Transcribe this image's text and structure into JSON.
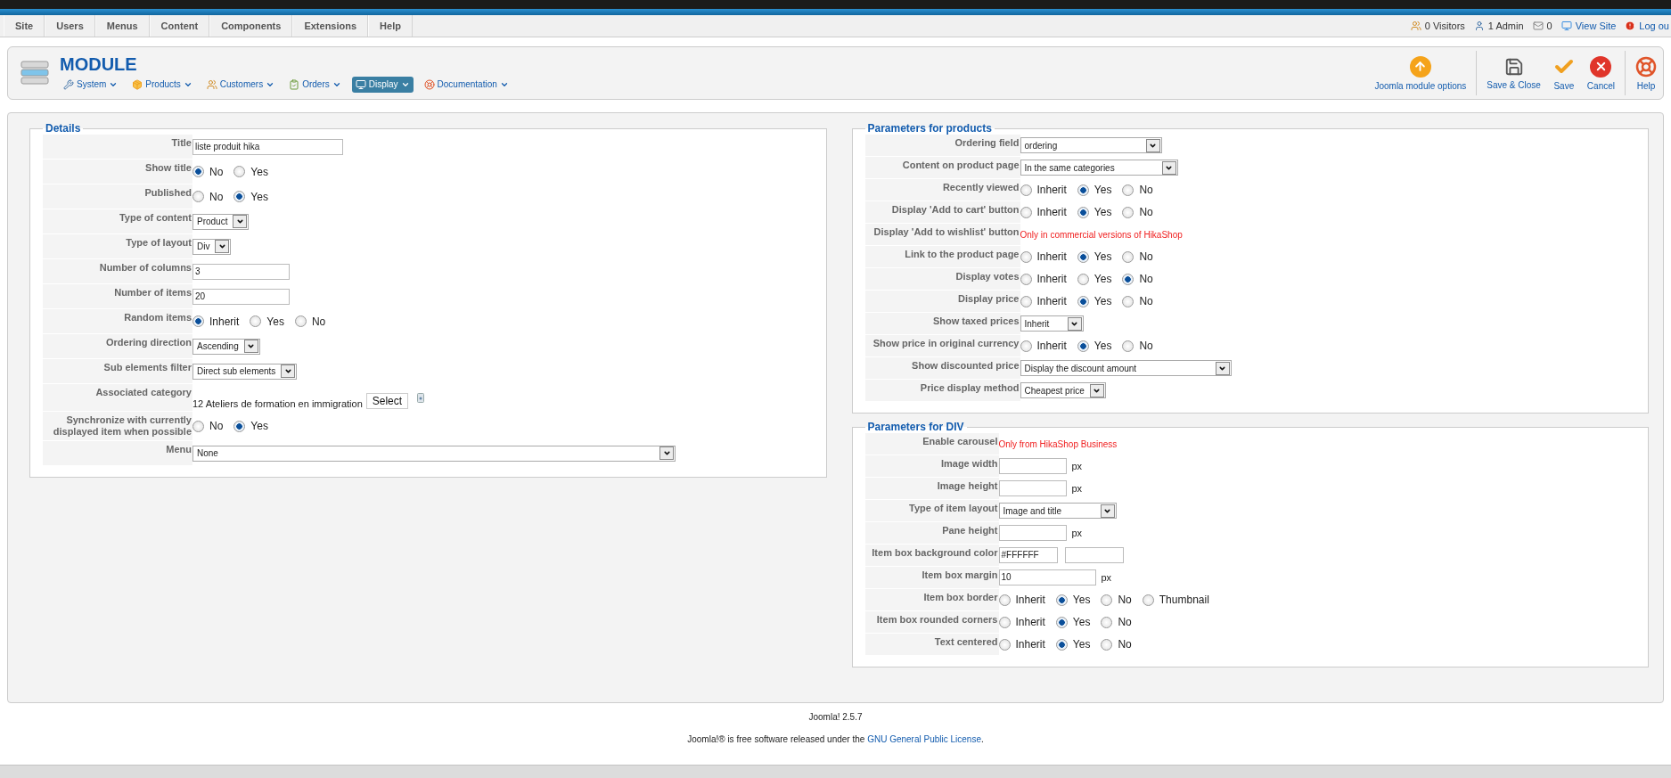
{
  "menu_bar": {
    "items": [
      {
        "label": "Site"
      },
      {
        "label": "Users"
      },
      {
        "label": "Menus"
      },
      {
        "label": "Content"
      },
      {
        "label": "Components"
      },
      {
        "label": "Extensions"
      },
      {
        "label": "Help"
      }
    ],
    "status": [
      {
        "kind": "visitors",
        "text": "0 Visitors"
      },
      {
        "kind": "admin",
        "text": "1 Admin"
      },
      {
        "kind": "mail",
        "text": "0"
      },
      {
        "kind": "site",
        "text": "View Site"
      },
      {
        "kind": "logout",
        "text": "Log ou"
      }
    ]
  },
  "toolbar": {
    "title": "MODULE",
    "menus": [
      {
        "label": "System",
        "selected": false
      },
      {
        "label": "Products",
        "selected": false
      },
      {
        "label": "Customers",
        "selected": false
      },
      {
        "label": "Orders",
        "selected": false
      },
      {
        "label": "Display",
        "selected": true
      },
      {
        "label": "Documentation",
        "selected": false
      }
    ],
    "buttons": [
      {
        "label": "Joomla module options"
      },
      {
        "label": "Save & Close"
      },
      {
        "label": "Save"
      },
      {
        "label": "Cancel"
      },
      {
        "label": "Help"
      }
    ]
  },
  "panels": [
    {
      "title": "Details",
      "fields": [
        {
          "label": "Title",
          "kind": "text",
          "value": "liste produit hika"
        },
        {
          "label": "Show title",
          "kind": "radio",
          "options": [
            {
              "label": "No",
              "selected": true
            },
            {
              "label": "Yes",
              "selected": false
            }
          ]
        },
        {
          "label": "Published",
          "kind": "radio",
          "options": [
            {
              "label": "No",
              "selected": false
            },
            {
              "label": "Yes",
              "selected": true
            }
          ]
        },
        {
          "label": "Type of content",
          "kind": "select",
          "value": "Product"
        },
        {
          "label": "Type of layout",
          "kind": "select",
          "value": "Div"
        },
        {
          "label": "Number of columns",
          "kind": "text",
          "value": "3"
        },
        {
          "label": "Number of items",
          "kind": "text",
          "value": "20"
        },
        {
          "label": "Random items",
          "kind": "radio",
          "options": [
            {
              "label": "Inherit",
              "selected": true
            },
            {
              "label": "Yes",
              "selected": false
            },
            {
              "label": "No",
              "selected": false
            }
          ]
        },
        {
          "label": "Ordering direction",
          "kind": "select",
          "value": "Ascending"
        },
        {
          "label": "Sub elements filter",
          "kind": "select",
          "value": "Direct sub elements"
        },
        {
          "label": "Associated category",
          "kind": "category",
          "value": "12 Ateliers de formation en immigration",
          "button": "Select"
        },
        {
          "label": "Synchronize with currently displayed item when possible",
          "kind": "radio",
          "options": [
            {
              "label": "No",
              "selected": false
            },
            {
              "label": "Yes",
              "selected": true
            }
          ]
        },
        {
          "label": "Menu",
          "kind": "select",
          "value": "None"
        }
      ]
    },
    {
      "title": "Parameters for products",
      "fields": [
        {
          "label": "Ordering field",
          "kind": "select",
          "value": "ordering"
        },
        {
          "label": "Content on product page",
          "kind": "select",
          "value": "In the same categories"
        },
        {
          "label": "Recently viewed",
          "kind": "radio",
          "options": [
            {
              "label": "Inherit",
              "selected": false
            },
            {
              "label": "Yes",
              "selected": true
            },
            {
              "label": "No",
              "selected": false
            }
          ]
        },
        {
          "label": "Display 'Add to cart' button",
          "kind": "radio",
          "options": [
            {
              "label": "Inherit",
              "selected": false
            },
            {
              "label": "Yes",
              "selected": true
            },
            {
              "label": "No",
              "selected": false
            }
          ]
        },
        {
          "label": "Display 'Add to wishlist' button",
          "kind": "note",
          "value": "Only in commercial versions of HikaShop"
        },
        {
          "label": "Link to the product page",
          "kind": "radio",
          "options": [
            {
              "label": "Inherit",
              "selected": false
            },
            {
              "label": "Yes",
              "selected": true
            },
            {
              "label": "No",
              "selected": false
            }
          ]
        },
        {
          "label": "Display votes",
          "kind": "radio",
          "options": [
            {
              "label": "Inherit",
              "selected": false
            },
            {
              "label": "Yes",
              "selected": false
            },
            {
              "label": "No",
              "selected": true
            }
          ]
        },
        {
          "label": "Display price",
          "kind": "radio",
          "options": [
            {
              "label": "Inherit",
              "selected": false
            },
            {
              "label": "Yes",
              "selected": true
            },
            {
              "label": "No",
              "selected": false
            }
          ]
        },
        {
          "label": "Show taxed prices",
          "kind": "select",
          "value": "Inherit"
        },
        {
          "label": "Show price in original currency",
          "kind": "radio",
          "options": [
            {
              "label": "Inherit",
              "selected": false
            },
            {
              "label": "Yes",
              "selected": true
            },
            {
              "label": "No",
              "selected": false
            }
          ]
        },
        {
          "label": "Show discounted price",
          "kind": "select",
          "value": "Display the discount amount"
        },
        {
          "label": "Price display method",
          "kind": "select",
          "value": "Cheapest price"
        }
      ]
    },
    {
      "title": "Parameters for DIV",
      "fields": [
        {
          "label": "Enable carousel",
          "kind": "note",
          "value": "Only from HikaShop Business"
        },
        {
          "label": "Image width",
          "kind": "px",
          "unit": "px"
        },
        {
          "label": "Image height",
          "kind": "px",
          "unit": "px"
        },
        {
          "label": "Type of item layout",
          "kind": "select",
          "value": "Image and title"
        },
        {
          "label": "Pane height",
          "kind": "px",
          "unit": "px"
        },
        {
          "label": "Item box background color",
          "kind": "color",
          "value": "#FFFFFF"
        },
        {
          "label": "Item box margin",
          "kind": "px",
          "value": "10",
          "unit": "px"
        },
        {
          "label": "Item box border",
          "kind": "radio",
          "options": [
            {
              "label": "Inherit",
              "selected": false
            },
            {
              "label": "Yes",
              "selected": true
            },
            {
              "label": "No",
              "selected": false
            },
            {
              "label": "Thumbnail",
              "selected": false
            }
          ]
        },
        {
          "label": "Item box rounded corners",
          "kind": "radio",
          "options": [
            {
              "label": "Inherit",
              "selected": false
            },
            {
              "label": "Yes",
              "selected": true
            },
            {
              "label": "No",
              "selected": false
            }
          ]
        },
        {
          "label": "Text centered",
          "kind": "radio",
          "options": [
            {
              "label": "Inherit",
              "selected": false
            },
            {
              "label": "Yes",
              "selected": true
            },
            {
              "label": "No",
              "selected": false
            }
          ]
        }
      ]
    }
  ],
  "footer": {
    "version": "Joomla! 2.5.7",
    "license": {
      "before": "Joomla!® is free software released under the ",
      "link": "GNU General Public License",
      "after": "."
    }
  }
}
